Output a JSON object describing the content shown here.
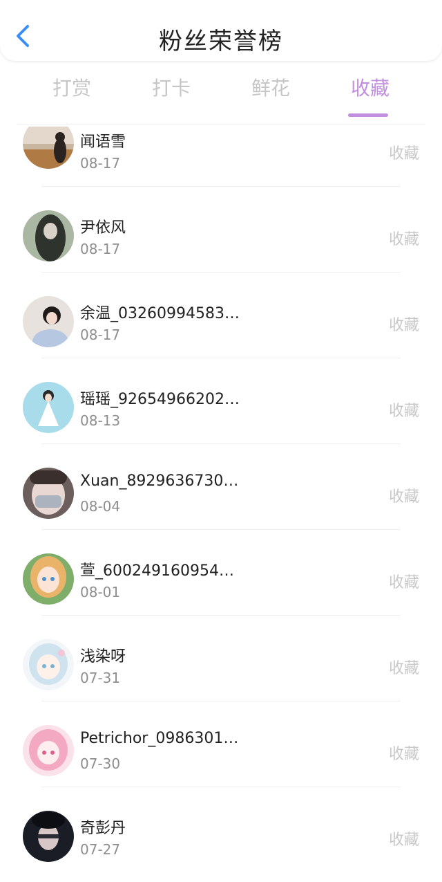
{
  "header": {
    "title": "粉丝荣誉榜",
    "back_icon": "chevron-left-icon",
    "back_color": "#3a8ef5"
  },
  "tabs": [
    {
      "label": "打赏",
      "active": false
    },
    {
      "label": "打卡",
      "active": false
    },
    {
      "label": "鲜花",
      "active": false
    },
    {
      "label": "收藏",
      "active": true
    }
  ],
  "accent_color": "#c28fe0",
  "fans": [
    {
      "name": "闻语雪",
      "date": "08-17",
      "action": "收藏"
    },
    {
      "name": "尹依风",
      "date": "08-17",
      "action": "收藏"
    },
    {
      "name": "余温_03260994583…",
      "date": "08-17",
      "action": "收藏"
    },
    {
      "name": "瑶瑶_92654966202…",
      "date": "08-13",
      "action": "收藏"
    },
    {
      "name": "Xuan_8929636730…",
      "date": "08-04",
      "action": "收藏"
    },
    {
      "name": "萱_600249160954…",
      "date": "08-01",
      "action": "收藏"
    },
    {
      "name": "浅染呀",
      "date": "07-31",
      "action": "收藏"
    },
    {
      "name": "Petrichor_0986301…",
      "date": "07-30",
      "action": "收藏"
    },
    {
      "name": "奇彭丹",
      "date": "07-27",
      "action": "收藏"
    }
  ]
}
